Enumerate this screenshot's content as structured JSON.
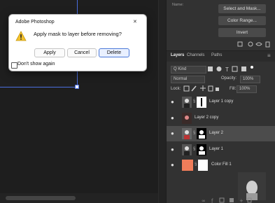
{
  "dialog": {
    "title": "Adobe Photoshop",
    "close_glyph": "✕",
    "message": "Apply mask to layer before removing?",
    "buttons": {
      "apply": "Apply",
      "cancel": "Cancel",
      "delete": "Delete"
    },
    "checkbox_label": "Don't show again",
    "checkbox_checked": false,
    "warning_icon": "warning-triangle-icon"
  },
  "properties_panel": {
    "section_label": "Name:",
    "buttons": {
      "select_and_mask": "Select and Mask...",
      "color_range": "Color Range...",
      "invert": "Invert"
    }
  },
  "layers_panel": {
    "tabs": [
      "Layers",
      "Channels",
      "Paths"
    ],
    "kind_filter": "Q Kind",
    "blend_mode": "Normal",
    "opacity_label": "Opacity:",
    "opacity_value": "100%",
    "lock_label": "Lock:",
    "fill_label": "Fill:",
    "fill_value": "100%",
    "layers": [
      {
        "name": "Layer 1 copy",
        "selected": false
      },
      {
        "name": "Layer 2 copy",
        "selected": false
      },
      {
        "name": "Layer 2",
        "selected": true
      },
      {
        "name": "Layer 1",
        "selected": false
      },
      {
        "name": "Color Fill 1",
        "selected": false
      }
    ],
    "accent_color": "#f07d5a"
  }
}
